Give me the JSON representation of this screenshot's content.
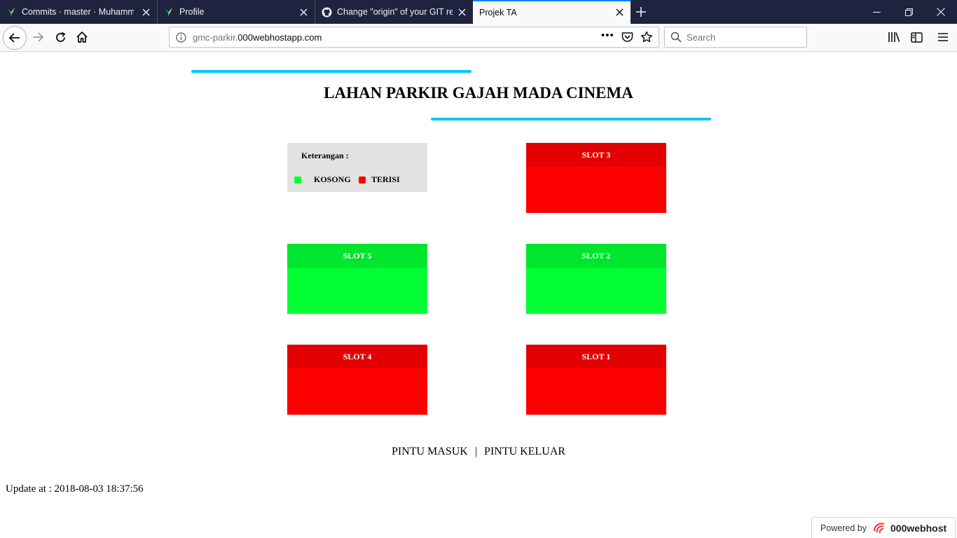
{
  "browser": {
    "tabs": [
      {
        "title": "Commits · master · Muhammad",
        "favicon": "hummingbird-icon"
      },
      {
        "title": "Profile",
        "favicon": "hummingbird-icon"
      },
      {
        "title": "Change \"origin\" of your GIT repository",
        "favicon": "github-icon"
      },
      {
        "title": "Projek TA",
        "favicon": "none",
        "active": true
      }
    ],
    "url": {
      "prefix": "gmc-parkir.",
      "domain": "000webhostapp.com"
    },
    "search_placeholder": "Search",
    "page_actions": "•••"
  },
  "page": {
    "title": "LAHAN PARKIR GAJAH MADA CINEMA",
    "legend": {
      "title": "Keterangan :",
      "empty_label": "KOSONG",
      "full_label": "TERISI",
      "empty_color": "#00ff33",
      "full_color": "#ff0000"
    },
    "slots": [
      {
        "label": "SLOT 3",
        "status": "terisi"
      },
      {
        "label": "SLOT 5",
        "status": "kosong"
      },
      {
        "label": "SLOT 2",
        "status": "kosong"
      },
      {
        "label": "SLOT 4",
        "status": "terisi"
      },
      {
        "label": "SLOT 1",
        "status": "terisi"
      }
    ],
    "gates": {
      "entry": "PINTU MASUK",
      "separator": "|",
      "exit": "PINTU KELUAR"
    },
    "update": "Update at : 2018-08-03 18:37:56",
    "accent_color": "#00c8f4"
  },
  "badge": {
    "prefix": "Powered by",
    "brand": "000webhost"
  }
}
